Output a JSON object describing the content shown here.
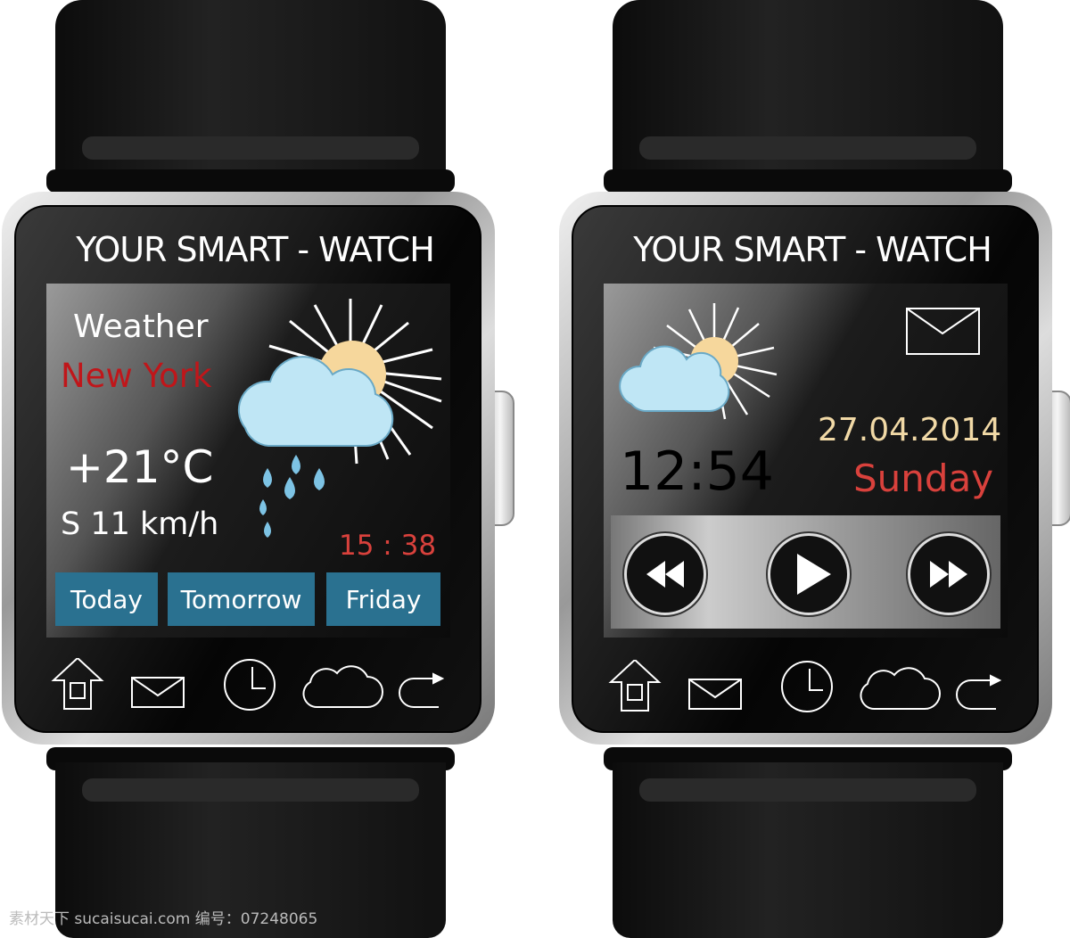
{
  "watches": [
    {
      "brand": "YOUR SMART - WATCH",
      "screen": "weather",
      "weather": {
        "title": "Weather",
        "city": "New York",
        "temperature": "+21°C",
        "wind": "S 11 km/h",
        "time": "15 : 38",
        "icon": "sun-cloud-rain-icon"
      },
      "tabs": [
        "Today",
        "Tomorrow",
        "Friday"
      ],
      "nav_icons": [
        "home-icon",
        "mail-icon",
        "clock-icon",
        "cloud-icon",
        "forward-icon"
      ]
    },
    {
      "brand": "YOUR SMART - WATCH",
      "screen": "home",
      "home": {
        "time": "12:54",
        "date": "27.04.2014",
        "day": "Sunday",
        "icon": "sun-cloud-icon",
        "mail_icon": "mail-icon"
      },
      "media": [
        "rewind-icon",
        "play-icon",
        "fast-forward-icon"
      ],
      "nav_icons": [
        "home-icon",
        "mail-icon",
        "clock-icon",
        "cloud-icon",
        "forward-icon"
      ]
    }
  ],
  "colors": {
    "city": "#c0161a",
    "time_red": "#d9413c",
    "date": "#f1d9a6",
    "day": "#d9413c",
    "tab": "#2a7190"
  },
  "watermark": "素材天下 sucaisucai.com  编号：07248065"
}
